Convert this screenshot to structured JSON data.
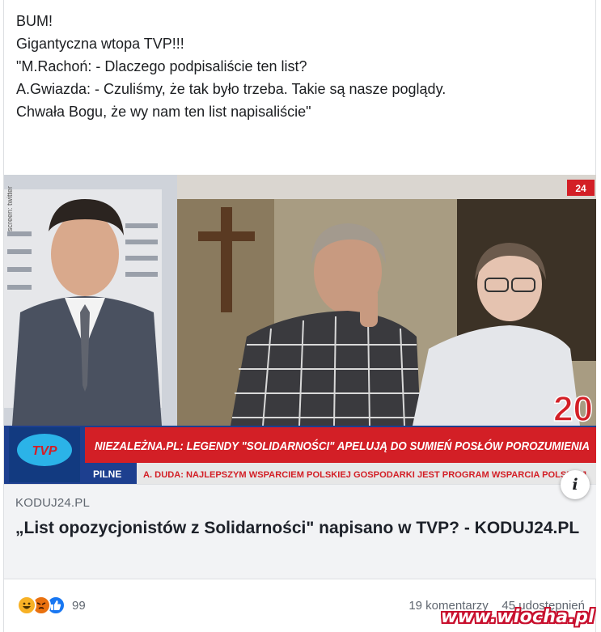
{
  "post": {
    "lines": [
      "BUM!",
      "Gigantyczna wtopa TVP!!!",
      "\"M.Rachoń: - Dlaczego podpisaliście ten list?",
      "A.Gwiazda: - Czuliśmy, że tak było trzeba. Takie są nasze poglądy.",
      "Chwała Bogu, że wy nam ten list napisaliście\""
    ]
  },
  "preview": {
    "side_caption": "screen: twitter",
    "channel_badge": "24",
    "channel_number": "20",
    "ticker_headline": "NIEZALEŻNA.PL: LEGENDY \"SOLIDARNOŚCI\" APELUJĄ DO SUMIEŃ POSŁÓW POROZUMIENIA",
    "ticker_label": "PILNE",
    "ticker_sub": "A. DUDA: NAJLEPSZYM WSPARCIEM POLSKIEJ GOSPODARKI JEST PROGRAM WSPARCIA POLSKIEJ",
    "logo_text": "TVP"
  },
  "link": {
    "domain": "KODUJ24.PL",
    "title": "„List opozycjonistów z Solidarności\" napisano w TVP? - KODUJ24.PL",
    "info_icon": "info-icon"
  },
  "footer": {
    "reaction_icons": [
      "haha-reaction-icon",
      "angry-reaction-icon",
      "like-reaction-icon"
    ],
    "reaction_count": "99",
    "comments": "19 komentarzy",
    "shares": "45 udostępnień"
  },
  "watermark": "www.wiocha.pl",
  "colors": {
    "ticker_red": "#d31f26",
    "like_blue": "#1877f2",
    "haha_yellow": "#f7b125",
    "angry_orange": "#e9710f",
    "watermark_red": "#c8102e"
  }
}
